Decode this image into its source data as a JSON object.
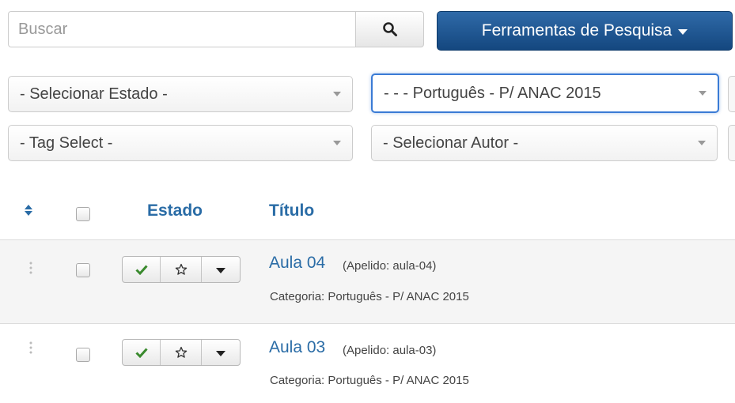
{
  "search": {
    "placeholder": "Buscar",
    "value": ""
  },
  "toolbar": {
    "search_icon": "search-icon",
    "tools_label": "Ferramentas de Pesquisa"
  },
  "filters": {
    "state": "- Selecionar Estado -",
    "language": "- - - Português - P/ ANAC 2015",
    "tag": "- Tag Select -",
    "author": "- Selecionar Autor -"
  },
  "table": {
    "headers": {
      "sort_icon": "sort-icon",
      "status": "Estado",
      "title": "Título"
    },
    "rows": [
      {
        "title": "Aula 04",
        "alias": "(Apelido: aula-04)",
        "category": "Categoria: Português - P/ ANAC 2015",
        "published": true,
        "featured": false
      },
      {
        "title": "Aula 03",
        "alias": "(Apelido: aula-03)",
        "category": "Categoria: Português - P/ ANAC 2015",
        "published": true,
        "featured": false
      }
    ]
  },
  "colors": {
    "primary_button": "#14477f",
    "link": "#2a6ca6",
    "publish_check": "#3a8a2e",
    "focus_border": "#3a7bd5"
  }
}
